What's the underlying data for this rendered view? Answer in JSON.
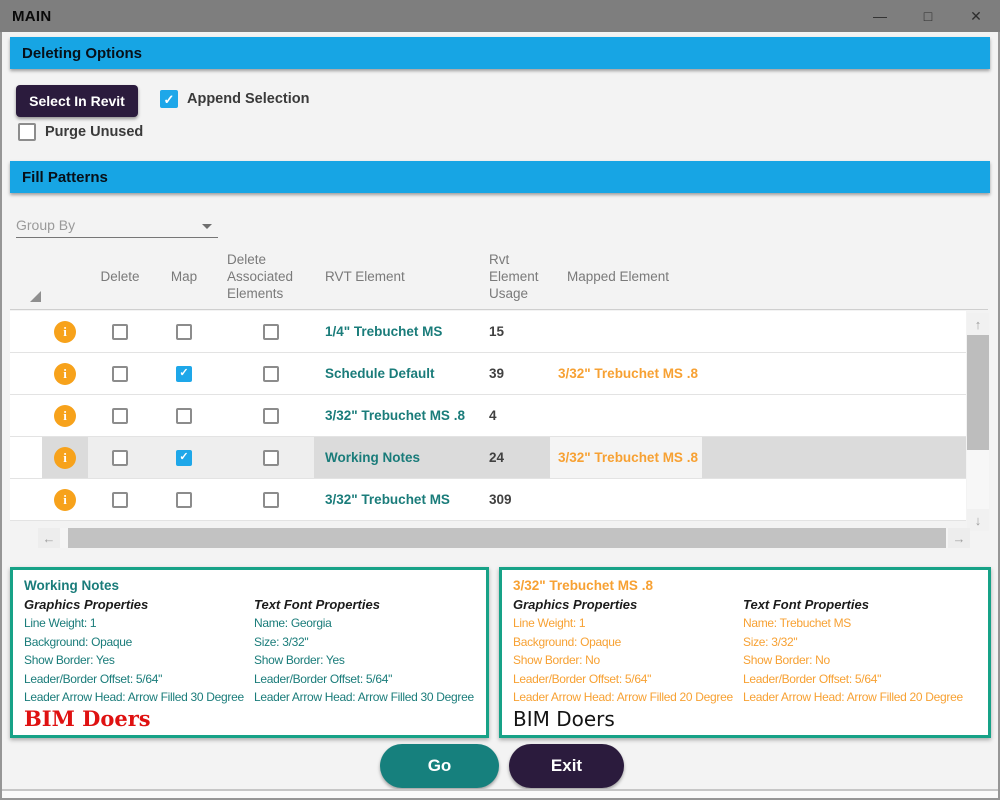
{
  "window": {
    "title": "MAIN",
    "minimize": "—",
    "maximize": "□",
    "close": "✕"
  },
  "icons": {
    "check": "✓",
    "info": "i",
    "up": "↑",
    "down": "↓",
    "left": "←",
    "right": "→"
  },
  "colors": {
    "titlebar_gray": "#7E7E7E",
    "header_cyan": "#17A5E4",
    "dark_purple": "#2B1B3D",
    "check_cyan": "#1EA7E9",
    "info_orange": "#F7A21B",
    "teal_text": "#1A7C7A",
    "orange_text": "#F7A133",
    "panel_green": "#17A287",
    "go_teal": "#16807D",
    "sample_red": "#DF1111"
  },
  "deleting_options": {
    "title": "Deleting Options",
    "select_in_revit": "Select In Revit",
    "append_selection": "Append Selection",
    "append_checked": true,
    "purge_unused": "Purge Unused",
    "purge_checked": false
  },
  "fill_patterns": {
    "title": "Fill Patterns",
    "group_by": "Group By"
  },
  "table": {
    "headers": {
      "delete": "Delete",
      "map": "Map",
      "delete_associated": "Delete Associated Elements",
      "rvt_element": "RVT Element",
      "rvt_usage": "Rvt Element Usage",
      "mapped": "Mapped Element"
    },
    "rows": [
      {
        "delete": false,
        "map": false,
        "assoc": false,
        "rvt": "1/4\" Trebuchet MS",
        "usage": "15",
        "mapped": "",
        "selected": false
      },
      {
        "delete": false,
        "map": true,
        "assoc": false,
        "rvt": "Schedule Default",
        "usage": "39",
        "mapped": "3/32\" Trebuchet MS .8",
        "selected": false
      },
      {
        "delete": false,
        "map": false,
        "assoc": false,
        "rvt": "3/32\" Trebuchet MS .8",
        "usage": "4",
        "mapped": "",
        "selected": false
      },
      {
        "delete": false,
        "map": true,
        "assoc": false,
        "rvt": "Working Notes",
        "usage": "24",
        "mapped": "3/32\" Trebuchet MS .8",
        "selected": true
      },
      {
        "delete": false,
        "map": false,
        "assoc": false,
        "rvt": "3/32\" Trebuchet MS",
        "usage": "309",
        "mapped": "",
        "selected": false
      }
    ]
  },
  "details": [
    {
      "title": "Working Notes",
      "graphics_heading": "Graphics Properties",
      "graphics_lines": [
        "Line Weight: 1",
        "Background: Opaque",
        "Show Border: Yes",
        "Leader/Border Offset: 5/64\"",
        "Leader Arrow Head: Arrow Filled 30 Degree"
      ],
      "font_heading": "Text Font Properties",
      "font_lines": [
        "Name: Georgia",
        "Size: 3/32\"",
        "Show Border: Yes",
        "Leader/Border Offset: 5/64\"",
        "Leader Arrow Head: Arrow Filled 30 Degree"
      ],
      "sample": "BIM Doers"
    },
    {
      "title": "3/32\" Trebuchet MS .8",
      "graphics_heading": "Graphics Properties",
      "graphics_lines": [
        "Line Weight: 1",
        "Background: Opaque",
        "Show Border: No",
        "Leader/Border Offset: 5/64\"",
        "Leader Arrow Head: Arrow Filled 20 Degree"
      ],
      "font_heading": "Text Font Properties",
      "font_lines": [
        "Name: Trebuchet MS",
        "Size: 3/32\"",
        "Show Border: No",
        "Leader/Border Offset: 5/64\"",
        "Leader Arrow Head: Arrow Filled 20 Degree"
      ],
      "sample": "BIM Doers"
    }
  ],
  "footer": {
    "go": "Go",
    "exit": "Exit"
  }
}
